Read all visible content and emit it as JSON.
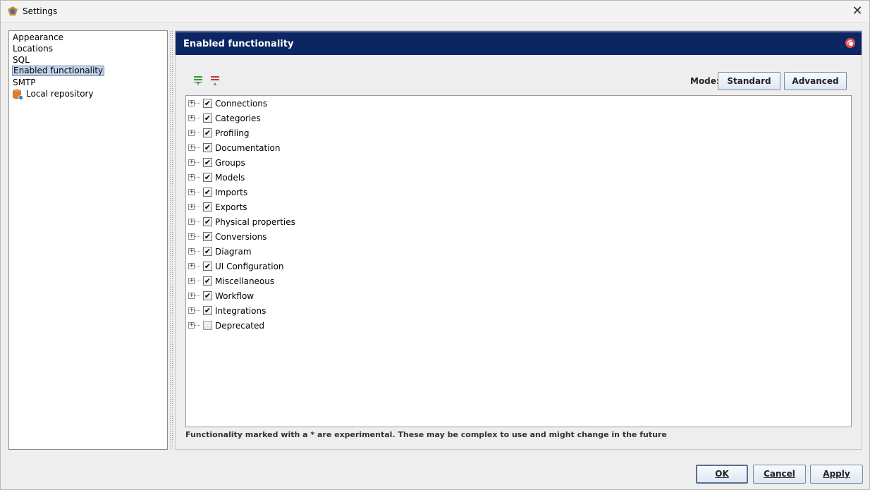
{
  "window": {
    "title": "Settings",
    "close_label": "✕"
  },
  "nav": {
    "items": [
      {
        "label": "Appearance",
        "selected": false
      },
      {
        "label": "Locations",
        "selected": false
      },
      {
        "label": "SQL",
        "selected": false
      },
      {
        "label": "Enabled functionality",
        "selected": true
      },
      {
        "label": "SMTP",
        "selected": false
      },
      {
        "label": "Local repository",
        "selected": false,
        "icon": "database-icon"
      }
    ]
  },
  "panel": {
    "title": "Enabled functionality",
    "mode_label": "Mode:",
    "standard_button": "Standard",
    "advanced_button": "Advanced",
    "expand_all_icon": "expand-all-icon",
    "collapse_all_icon": "collapse-all-icon",
    "help_icon": "help-lifebuoy-icon",
    "tree": [
      {
        "label": "Connections",
        "checked": true
      },
      {
        "label": "Categories",
        "checked": true
      },
      {
        "label": "Profiling",
        "checked": true
      },
      {
        "label": "Documentation",
        "checked": true
      },
      {
        "label": "Groups",
        "checked": true
      },
      {
        "label": "Models",
        "checked": true
      },
      {
        "label": "Imports",
        "checked": true
      },
      {
        "label": "Exports",
        "checked": true
      },
      {
        "label": "Physical properties",
        "checked": true
      },
      {
        "label": "Conversions",
        "checked": true
      },
      {
        "label": "Diagram",
        "checked": true
      },
      {
        "label": "UI Configuration",
        "checked": true
      },
      {
        "label": "Miscellaneous",
        "checked": true
      },
      {
        "label": "Workflow",
        "checked": true
      },
      {
        "label": "Integrations",
        "checked": true
      },
      {
        "label": "Deprecated",
        "checked": false
      }
    ],
    "footer_note": "Functionality marked with a * are experimental. These may be complex to use and might change in the future"
  },
  "buttons": {
    "ok": "OK",
    "cancel": "Cancel",
    "apply": "Apply"
  },
  "colors": {
    "header_bg": "#0c2563",
    "selection_bg": "#c4d3ea",
    "help_red": "#e24b4b"
  }
}
